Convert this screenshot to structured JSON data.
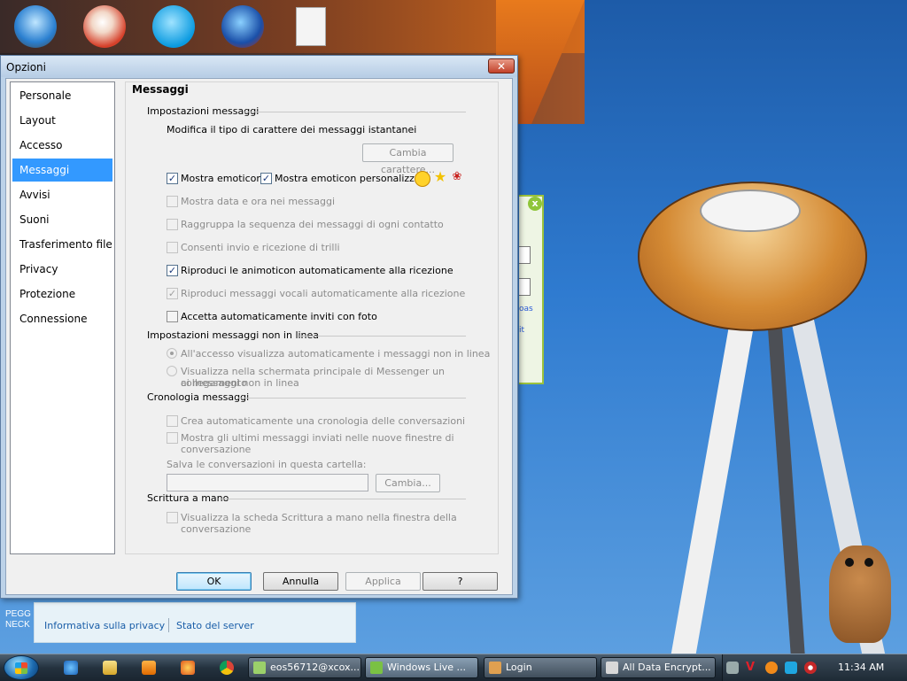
{
  "dialog": {
    "title": "Opzioni",
    "close_glyph": "✕",
    "nav": [
      "Personale",
      "Layout",
      "Accesso",
      "Messaggi",
      "Avvisi",
      "Suoni",
      "Trasferimento file",
      "Privacy",
      "Protezione",
      "Connessione"
    ],
    "selected": "Messaggi",
    "panel_title": "Messaggi",
    "sections": {
      "impostazioni": {
        "header": "Impostazioni messaggi",
        "font_desc": "Modifica il tipo di carattere dei messaggi istantanei",
        "change_font_btn": "Cambia carattere...",
        "show_emoticons": "Mostra emoticon",
        "show_custom_emoticons": "Mostra emoticon personalizzate",
        "show_datetime": "Mostra data e ora nei messaggi",
        "group_sequence": "Raggruppa la sequenza dei messaggi di ogni contatto",
        "allow_nudges": "Consenti invio e ricezione di trilli",
        "play_winks": "Riproduci le animoticon automaticamente alla ricezione",
        "play_voice": "Riproduci messaggi vocali automaticamente alla ricezione",
        "accept_photo": "Accetta automaticamente inviti con foto"
      },
      "offline": {
        "header": "Impostazioni messaggi non in linea",
        "opt1": "All'accesso visualizza automaticamente i messaggi non in linea",
        "opt2_line1": "Visualizza nella schermata principale di Messenger un collegamento",
        "opt2_line2": "ai messaggi non in linea"
      },
      "cronologia": {
        "header": "Cronologia messaggi",
        "create_history": "Crea automaticamente una cronologia delle conversazioni",
        "show_last_line1": "Mostra gli ultimi messaggi inviati nelle nuove finestre di",
        "show_last_line2": "conversazione",
        "save_folder_label": "Salva le conversazioni in questa cartella:",
        "change_btn": "Cambia..."
      },
      "scrittura": {
        "header": "Scrittura a mano",
        "show_tab_line1": "Visualizza la scheda Scrittura a mano nella finestra della",
        "show_tab_line2": "conversazione"
      }
    },
    "buttons": {
      "ok": "OK",
      "cancel": "Annulla",
      "apply": "Applica",
      "help": "?"
    },
    "checkmark": "✓"
  },
  "background": {
    "peg_line1": "PEGG",
    "peg_line2": "NECK",
    "privacy_link": "Informativa sulla privacy",
    "server_link": "Stato del server",
    "messenger_close": "x",
    "messenger_link1": "oas",
    "messenger_link2": "it"
  },
  "taskbar": {
    "tasks": [
      "eos56712@xcox...",
      "Windows Live ...",
      "Login",
      "All Data Encrypt..."
    ],
    "clock": "11:34 AM"
  },
  "colors": {
    "selection": "#3399ff",
    "link": "#1a5ea8",
    "messenger_green": "#8fc53a"
  },
  "icons": [
    "start-orb-icon",
    "ie-icon",
    "folder-icon",
    "media-player-icon",
    "firefox-icon",
    "chrome-icon",
    "messenger-icon",
    "login-icon",
    "document-icon",
    "smiley-icon",
    "star-icon",
    "rose-icon"
  ]
}
